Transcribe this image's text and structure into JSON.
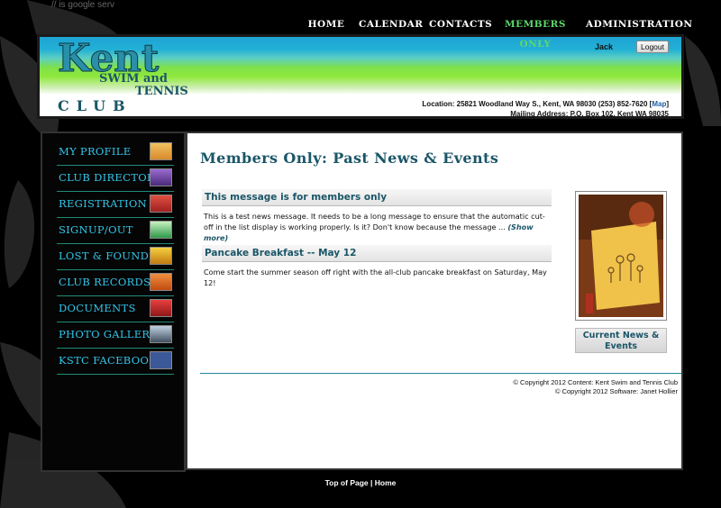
{
  "browser_snippet": "// is google serv",
  "nav": [
    {
      "label": "HOME",
      "active": false
    },
    {
      "label": "CALENDAR",
      "active": false
    },
    {
      "label": "CONTACTS",
      "active": false
    },
    {
      "label": "MEMBERS ONLY",
      "active": true
    },
    {
      "label": "ADMINISTRATION",
      "active": false
    }
  ],
  "header": {
    "logo": {
      "word1": "Kent",
      "word2": "SWIM and",
      "word3": "TENNIS",
      "word4": "CLUB"
    },
    "user": "Jack",
    "logout_label": "Logout",
    "location": "Location: 25821 Woodland Way S., Kent, WA 98030 (253) 852-7620 [",
    "map_link": "Map",
    "location_end": "]",
    "mailing": "Mailing Address: P.O. Box 102, Kent WA 98035"
  },
  "sidebar": [
    {
      "label": "MY PROFILE",
      "icon": "profile-icon",
      "color": "#d98a2a"
    },
    {
      "label": "CLUB DIRECTORY",
      "icon": "directory-icon",
      "color": "#6b3fa0"
    },
    {
      "label": "REGISTRATION",
      "icon": "registration-icon",
      "color": "#c0392b"
    },
    {
      "label": "SIGNUP/OUT",
      "icon": "signup-icon",
      "color": "#2e9a4a"
    },
    {
      "label": "LOST & FOUND",
      "icon": "lost-found-icon",
      "color": "#e0a020"
    },
    {
      "label": "CLUB RECORDS",
      "icon": "records-icon",
      "color": "#d76a1a"
    },
    {
      "label": "DOCUMENTS",
      "icon": "documents-icon",
      "color": "#c0282b"
    },
    {
      "label": "PHOTO GALLERY",
      "icon": "gallery-icon",
      "color": "#6f7f8f"
    },
    {
      "label": "KSTC FACEBOOK",
      "icon": "facebook-icon",
      "color": "#3b5998"
    }
  ],
  "main": {
    "title": "Members Only: Past News & Events",
    "news": [
      {
        "title": "This message is for members only",
        "body": "This is a test news message. It needs to be a long message to ensure that the automatic cut-off in the list display is working properly. Is it? Don't know because the message ...",
        "more": "(Show more)"
      },
      {
        "title": "Pancake Breakfast -- May 12",
        "body": "Come start the summer season off right with the all-club pancake breakfast on Saturday, May 12!",
        "more": ""
      }
    ],
    "current_button": "Current News & Events",
    "copyright1": "© Copyright 2012 Content: Kent Swim and Tennis Club",
    "copyright2": "© Copyright 2012 Software: Janet Hollier"
  },
  "footer": {
    "top": "Top of Page",
    "sep": " | ",
    "home": "Home"
  }
}
